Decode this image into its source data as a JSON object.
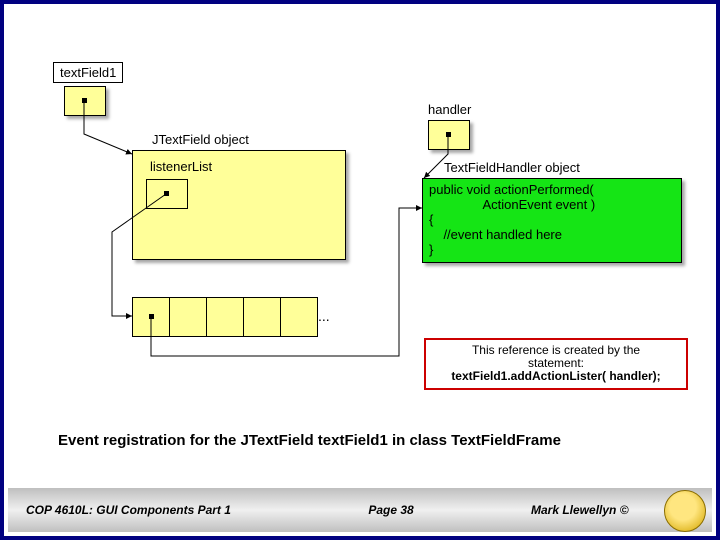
{
  "labels": {
    "textField1": "textField1",
    "handler": "handler",
    "jtextfield_object": "JTextField object",
    "listener_list": "listenerList",
    "tfh_object": "TextFieldHandler object"
  },
  "code_block": "public void actionPerformed(\n               ActionEvent event )\n{\n    //event handled here\n}",
  "note": {
    "line1": "This reference is created by the",
    "line2": "statement:",
    "line3": "textField1.addActionLister( handler);"
  },
  "ellipsis": "...",
  "caption": "Event registration for the JTextField textField1 in class TextFieldFrame",
  "footer": {
    "left": "COP 4610L: GUI Components Part 1",
    "center": "Page 38",
    "right": "Mark Llewellyn ©"
  }
}
